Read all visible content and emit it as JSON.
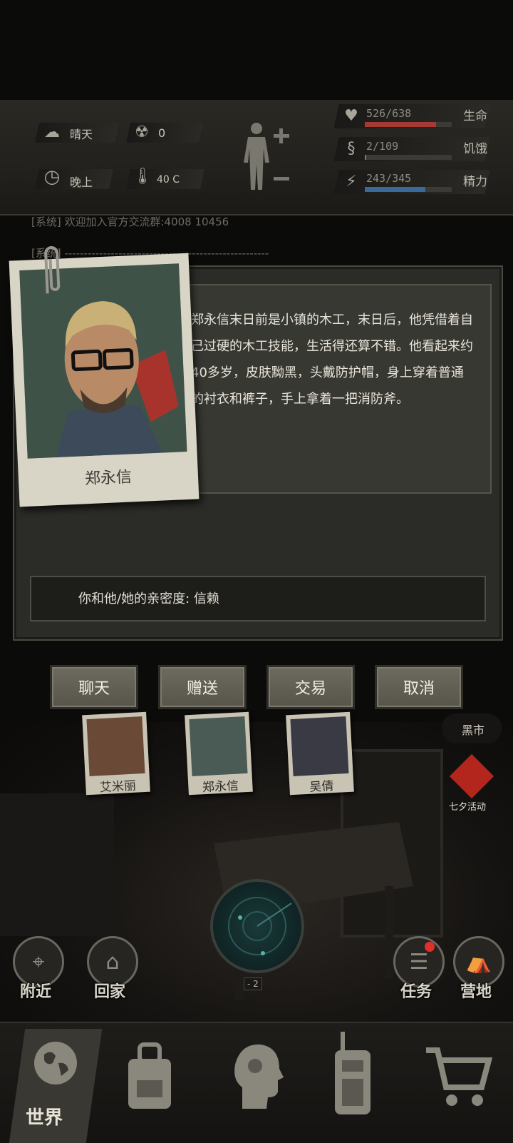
{
  "status": {
    "weather": "晴天",
    "radiation": "0",
    "time_of_day": "晚上",
    "temperature": "40 C",
    "health": {
      "value": "526/638",
      "label": "生命",
      "fraction": 0.82
    },
    "hunger": {
      "value": "2/109",
      "label": "饥饿",
      "fraction": 0.02
    },
    "energy": {
      "value": "243/345",
      "label": "精力",
      "fraction": 0.7
    },
    "colors": {
      "health": "#a63a32",
      "hunger": "#6b8a3a",
      "energy": "#3a6a9a"
    }
  },
  "chat": {
    "line1": "[系统]  欢迎加入官方交流群:4008 10456",
    "line2": "[系统] -----------------------------------------------------"
  },
  "npc": {
    "name": "郑永信",
    "description": "郑永信末日前是小镇的木工，末日后，他凭借着自己过硬的木工技能，生活得还算不错。他看起来约40多岁，皮肤黝黑，头戴防护帽，身上穿着普通的衬衣和裤子，手上拿着一把消防斧。",
    "affinity_text": "你和他/她的亲密度: 信赖"
  },
  "actions": {
    "chat": "聊天",
    "gift": "赠送",
    "trade": "交易",
    "cancel": "取消"
  },
  "scene": {
    "characters": [
      "艾米丽",
      "郑永信",
      "吴倩"
    ],
    "black_market": "黑市",
    "event": "七夕活动",
    "radar_level": "- 2",
    "nearby": "附近",
    "home": "回家",
    "tasks": "任务",
    "camp": "营地"
  },
  "bottom_nav": {
    "world": "世界",
    "icons": [
      "globe-icon",
      "backpack-icon",
      "skills-head-icon",
      "walkie-talkie-icon",
      "cart-icon"
    ]
  }
}
